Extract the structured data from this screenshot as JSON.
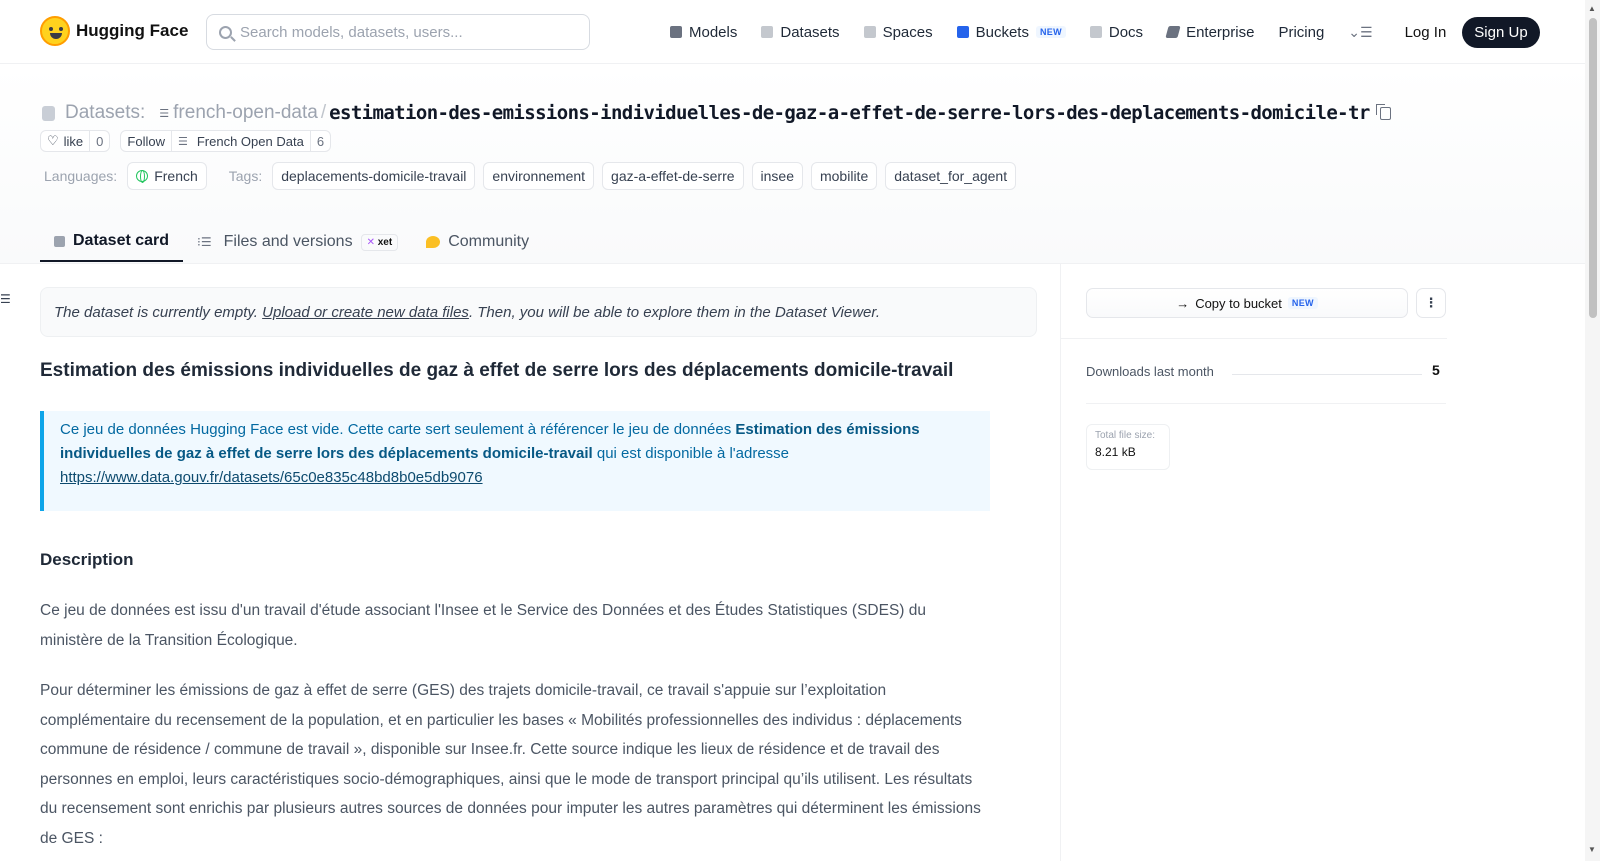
{
  "nav": {
    "brand": "Hugging Face",
    "search_placeholder": "Search models, datasets, users...",
    "links": [
      {
        "label": "Models",
        "icon": "cube-icon",
        "color": "#6b7280"
      },
      {
        "label": "Datasets",
        "icon": "database-icon",
        "color": "#9ca3af"
      },
      {
        "label": "Spaces",
        "icon": "grid-icon",
        "color": "#9ca3af"
      },
      {
        "label": "Buckets",
        "icon": "bucket-icon",
        "color": "#2563eb",
        "badge": "NEW"
      },
      {
        "label": "Docs",
        "icon": "book-icon",
        "color": "#9ca3af"
      },
      {
        "label": "Enterprise",
        "icon": "enterprise-icon",
        "color": "#6b7280"
      },
      {
        "label": "Pricing"
      }
    ],
    "login": "Log In",
    "signup": "Sign Up"
  },
  "header": {
    "section": "Datasets:",
    "org": "french-open-data",
    "separator": "/",
    "repo": "estimation-des-emissions-individuelles-de-gaz-a-effet-de-serre-lors-des-deplacements-domicile-tr",
    "like_label": "like",
    "like_count": "0",
    "follow_label": "Follow",
    "follow_org": "French Open Data",
    "follow_count": "6",
    "languages_label": "Languages:",
    "language": "French",
    "tags_label": "Tags:",
    "tags": [
      "deplacements-domicile-travail",
      "environnement",
      "gaz-a-effet-de-serre",
      "insee",
      "mobilite",
      "dataset_for_agent"
    ]
  },
  "tabs": {
    "dataset_card": "Dataset card",
    "files": "Files and versions",
    "xet": "xet",
    "community": "Community"
  },
  "main": {
    "notice_before": "The dataset is currently empty. ",
    "notice_link": "Upload or create new data files",
    "notice_after": ". Then, you will be able to explore them in the Dataset Viewer.",
    "title": "Estimation des émissions individuelles de gaz à effet de serre lors des déplacements domicile-travail",
    "callout_before": "Ce jeu de données Hugging Face est vide. Cette carte sert seulement à référencer le jeu de données ",
    "callout_bold": "Estimation des émissions individuelles de gaz à effet de serre lors des déplacements domicile-travail",
    "callout_after": " qui est disponible à l'adresse",
    "callout_link": "https://www.data.gouv.fr/datasets/65c0e835c48bd8b0e5db9076",
    "description_heading": "Description",
    "para1": "Ce jeu de données est issu d'un travail d'étude associant l'Insee et le Service des Données et des Études Statistiques (SDES) du ministère de la Transition Écologique.",
    "para2": "Pour déterminer les émissions de gaz à effet de serre (GES) des trajets domicile-travail, ce travail s'appuie sur l’exploitation complémentaire du recensement de la population, et en particulier les bases « Mobilités professionnelles des individus : déplacements commune de résidence / commune de travail », disponible sur Insee.fr. Cette source indique les lieux de résidence et de travail des personnes en emploi, leurs caractéristiques socio-démographiques, ainsi que le mode de transport principal qu’ils utilisent. Les résultats du recensement sont enrichis par plusieurs autres sources de données pour imputer les autres paramètres qui déterminent les émissions de GES :"
  },
  "sidebar": {
    "copy_bucket": "Copy to bucket",
    "new_badge": "NEW",
    "downloads_label": "Downloads last month",
    "downloads_value": "5",
    "size_label": "Total file size:",
    "size_value": "8.21 kB"
  }
}
